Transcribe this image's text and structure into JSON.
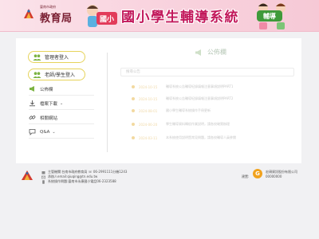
{
  "header": {
    "org_small": "臺南市政府",
    "org_title": "教育局",
    "badge_left": "國小",
    "banner_title": "國小學生輔導系統",
    "badge_right": "輔導"
  },
  "sidebar": {
    "admin_login": "管理者登入",
    "teacher_login": "老師/學生登入",
    "items": [
      {
        "label": "公佈欄",
        "icon": "megaphone-icon"
      },
      {
        "label": "檔案下載",
        "icon": "download-icon",
        "caret": "⌄"
      },
      {
        "label": "相關網站",
        "icon": "link-icon"
      },
      {
        "label": "Q&A",
        "icon": "chat-icon",
        "caret": "⌄"
      }
    ]
  },
  "content": {
    "title": "公佈欄",
    "search_placeholder": "搜尋公告",
    "notices": [
      {
        "date": "2024-10-15",
        "text": "輔導系統公告輔導紀錄填報注意事項說明PART1"
      },
      {
        "date": "2024-10-15",
        "text": "輔導系統公告輔導紀錄填報注意事項說明PART2"
      },
      {
        "date": "2024-08-01",
        "text": "國小學生輔導系統操作手冊更新"
      },
      {
        "date": "2024-06-20",
        "text": "學生輔導資料轉銜作業說明，請各校確實辦理"
      },
      {
        "date": "2024-03-11",
        "text": "本系統使用說明暨常見問題，請各校輔導人員參閱"
      }
    ]
  },
  "footer": {
    "line1": "主管機關:台南市政府教育局  ☏ 06-2991111分機1243",
    "line2": "承辦人email:qiuqing@tn.edu.tw",
    "line3": "系統操作問題:臺南市永康國小電話06-2323588",
    "sponsor_label": "建置:",
    "sponsor_name": "宏碩資訊股份有限公司",
    "sponsor_id": "00000000",
    "sponsor_logo_letter": "G"
  },
  "colors": {
    "accent_pink": "#c2185b",
    "pill_border": "#e6d35a",
    "sponsor_orange": "#f1a21d"
  }
}
